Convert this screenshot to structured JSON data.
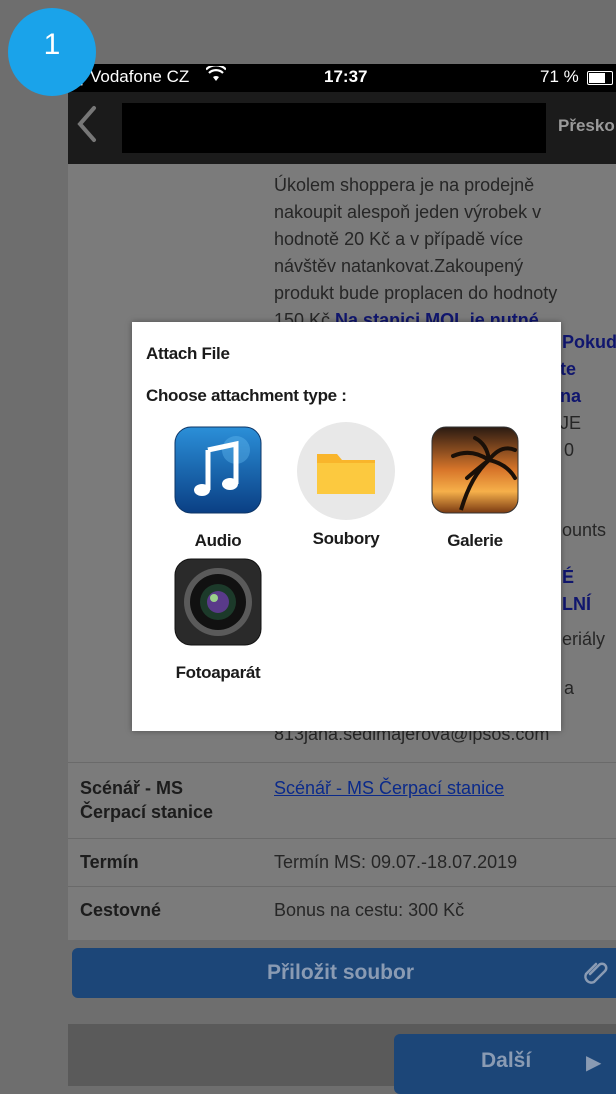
{
  "badge": "1",
  "status_bar": {
    "carrier": "Vodafone CZ",
    "time": "17:37",
    "battery": "71 %"
  },
  "nav": {
    "skip_label": "Přesko"
  },
  "description": {
    "lines": [
      "Úkolem shoppera je na prodejně",
      "nakoupit alespoň jeden výrobek v",
      "hodnotě 20 Kč a v případě více",
      "návštěv natankovat.Zakoupený",
      "produkt bude proplacen do hodnoty"
    ],
    "line6_plain": "150 Kč ",
    "line6_highlight": "Na stanici MOL je nutné"
  },
  "side_fragments": {
    "f1": "Pokud",
    "f2": "te",
    "f3": "na",
    "f4": "JE",
    "f5": "0",
    "f6": "ounts",
    "f7": "É",
    "f8": "LNÍ",
    "f9": "eriály",
    "f10": "a"
  },
  "email": "813jana.sedlmajerova@ipsos.com",
  "rows": {
    "scenario": {
      "label_1": "Scénář - MS",
      "label_2": "Čerpací stanice",
      "value": "Scénář - MS Čerpací stanice"
    },
    "term": {
      "label": "Termín",
      "value": "Termín MS: 09.07.-18.07.2019"
    },
    "travel": {
      "label": "Cestovné",
      "value": "Bonus na cestu: 300 Kč"
    }
  },
  "attach_button": {
    "label": "Přiložit soubor"
  },
  "next_button": {
    "label": "Další"
  },
  "dialog": {
    "title": "Attach File",
    "subtitle": "Choose attachment type :",
    "options": [
      {
        "label": "Audio",
        "icon": "music-note-icon"
      },
      {
        "label": "Soubory",
        "icon": "folder-icon"
      },
      {
        "label": "Galerie",
        "icon": "palm-sunset-icon"
      },
      {
        "label": "Fotoaparát",
        "icon": "camera-lens-icon"
      }
    ]
  },
  "colors": {
    "accent_blue": "#1aa3ea",
    "button_blue": "#1c4678",
    "link_blue": "#0b2a8a",
    "highlight_blue": "#10166e"
  }
}
